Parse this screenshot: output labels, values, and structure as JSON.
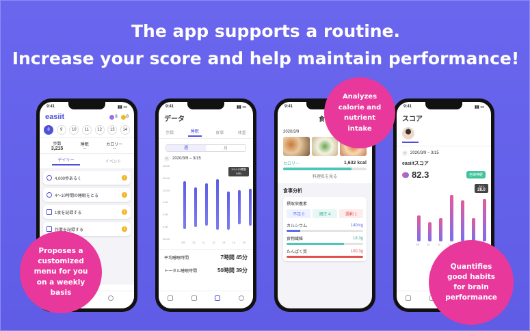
{
  "headline": {
    "line1": "The app supports a routine.",
    "line2": "Increase your score and help maintain performance!"
  },
  "badges": {
    "menu": "Proposes a customized menu for you on a weekly basis",
    "nutrient": "Analyzes calorie and nutrient intake",
    "habits": "Quantifies good habits for brain performance"
  },
  "status_time": "9:41",
  "phone1": {
    "logo": "easiit",
    "points": [
      "8",
      "8"
    ],
    "days": [
      "8",
      "9",
      "10",
      "11",
      "12",
      "13",
      "14"
    ],
    "stats": [
      {
        "label": "歩数",
        "value": "3,215"
      },
      {
        "label": "睡眠",
        "value": "--"
      },
      {
        "label": "カロリー",
        "value": "--"
      }
    ],
    "tabs": [
      "デイリー",
      "イベント"
    ],
    "tasks": [
      {
        "label": "4,000歩あるく",
        "pt": "1"
      },
      {
        "label": "4〜10時間の睡眠をとる",
        "pt": "1"
      },
      {
        "label": "1食を記録する",
        "pt": "2"
      },
      {
        "label": "作業を記録する",
        "pt": "1"
      }
    ]
  },
  "phone2": {
    "title": "データ",
    "tabs": [
      "歩数",
      "睡眠",
      "食事",
      "体重"
    ],
    "toggle": [
      "週",
      "月"
    ],
    "range": "2020/3/9 – 3/15",
    "yticks": [
      "18:00",
      "20:00",
      "22:00",
      "0:00",
      "2:00",
      "4:00",
      "06:00"
    ],
    "xlabels": [
      "3/9",
      "10",
      "11",
      "12",
      "13",
      "14",
      "15"
    ],
    "tooltip": "3/14 10時間 34分",
    "summary": [
      {
        "label": "平均睡眠時間",
        "value": "7時間 45分"
      },
      {
        "label": "トータル睡眠時間",
        "value": "50時間 39分"
      }
    ]
  },
  "phone3": {
    "title": "食事",
    "date": "2020/3/9",
    "cal_label": "カロリー",
    "cal_value": "1,632 kcal",
    "link": "料理名を見る",
    "section": "食事分析",
    "sub": "摂取栄養素",
    "chips": [
      "不足 0",
      "適正 4",
      "過剰 1"
    ],
    "nutrients": [
      {
        "name": "カルシウム",
        "value": "140mg"
      },
      {
        "name": "食物繊維",
        "value": "18.3g"
      },
      {
        "name": "たんぱく質",
        "value": "100.3g"
      }
    ]
  },
  "phone4": {
    "title": "スコア",
    "range": "2020/3/9 – 3/15",
    "score_label": "easiitスコア",
    "score": "82.3",
    "tag": "自律神経",
    "tooltip_label": "3/14",
    "tooltip_value": "28.0",
    "xlabels": [
      "3/9",
      "10",
      "11",
      "12",
      "13",
      "14",
      "15"
    ]
  }
}
